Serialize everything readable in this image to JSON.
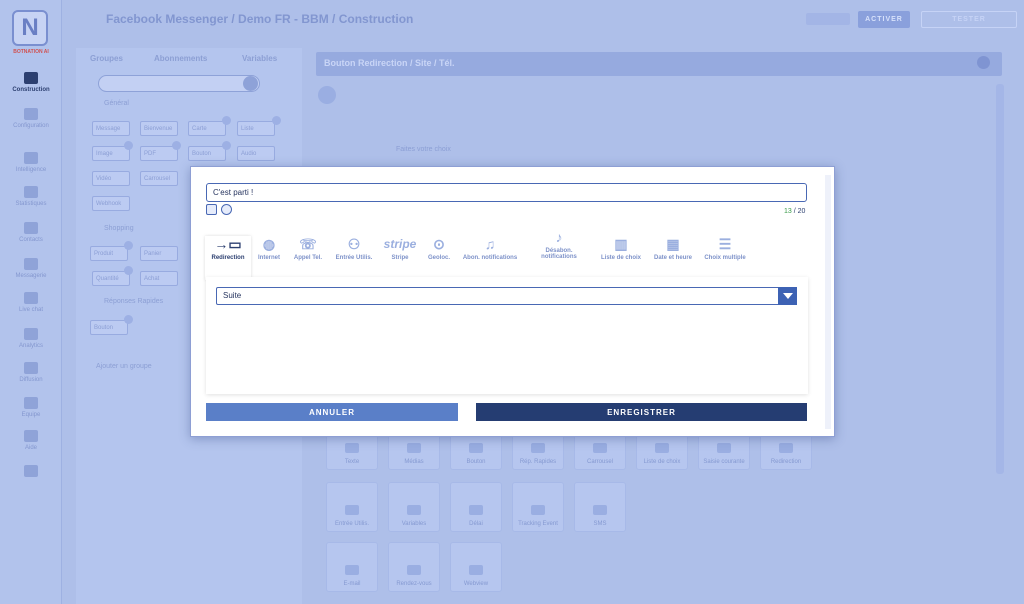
{
  "header": {
    "logo_letter": "N",
    "logo_text": "BOTNATION AI",
    "title": "Facebook Messenger / Demo FR - BBM / Construction",
    "activate_label": "ACTIVER",
    "test_label": "TESTER"
  },
  "rail": {
    "items": [
      {
        "label": "Construction",
        "icon": "wrench-icon",
        "active": true
      },
      {
        "label": "Configuration",
        "icon": "config-icon"
      },
      {
        "label": "Intelligence",
        "icon": "gear-icon"
      },
      {
        "label": "Statistiques",
        "icon": "stats-icon"
      },
      {
        "label": "Contacts",
        "icon": "contacts-icon"
      },
      {
        "label": "Messagerie",
        "icon": "chat-icon"
      },
      {
        "label": "Live chat",
        "icon": "headset-icon"
      },
      {
        "label": "Analytics",
        "icon": "chart-icon"
      },
      {
        "label": "Diffusion",
        "icon": "broadcast-icon"
      },
      {
        "label": "Equipe",
        "icon": "team-icon"
      },
      {
        "label": "Aide",
        "icon": "help-icon"
      },
      {
        "label": "",
        "icon": "gift-icon"
      }
    ]
  },
  "panel": {
    "tabs": [
      "Groupes",
      "Abonnements",
      "Variables"
    ],
    "section_general": "Général",
    "chips_general": [
      "Message",
      "Bienvenue",
      "Carte",
      "Liste",
      "Image",
      "PDF",
      "Bouton",
      "Audio",
      "Vidéo",
      "Carrousel",
      "Webhook"
    ],
    "section_ecommerce": "Shopping",
    "chips_ecommerce": [
      "Produit",
      "Panier",
      "Quantité",
      "Achat"
    ],
    "section_responses": "Réponses Rapides",
    "chips_responses": [
      "Bouton"
    ],
    "footer_label": "Ajouter un groupe"
  },
  "main": {
    "title": "Bouton Redirection / Site / Tél.",
    "flow_label": "Faites votre choix",
    "tiles_row1": [
      "Texte",
      "Médias",
      "Bouton",
      "Rép. Rapides",
      "Carrousel",
      "Liste de choix",
      "Saisie courante",
      "Redirection"
    ],
    "tiles_row2": [
      "Entrée Utilis.",
      "Variables",
      "Délai",
      "Tracking Event",
      "SMS"
    ],
    "tiles_row3": [
      "E-mail",
      "Rendez-vous",
      "Webview"
    ]
  },
  "modal": {
    "button_text": "C'est parti !",
    "counter_used": "13",
    "counter_sep": " / ",
    "counter_max": "20",
    "tabs": [
      {
        "label": "Redirection",
        "icon": "redirect-icon",
        "glyph": "→▭",
        "active": true
      },
      {
        "label": "Internet",
        "icon": "globe-icon",
        "glyph": "◍"
      },
      {
        "label": "Appel Tel.",
        "icon": "phone-icon",
        "glyph": "☏"
      },
      {
        "label": "Entrée Utilis.",
        "icon": "user-input-icon",
        "glyph": "⚇"
      },
      {
        "label": "Stripe",
        "icon": "stripe-icon",
        "glyph": "stripe"
      },
      {
        "label": "Geoloc.",
        "icon": "location-icon",
        "glyph": "⊙"
      },
      {
        "label": "Abon. notifications",
        "icon": "bell-icon",
        "glyph": "♫"
      },
      {
        "label": "Désabon. notifications",
        "icon": "bell-off-icon",
        "glyph": "♪"
      },
      {
        "label": "Liste de choix",
        "icon": "list-icon",
        "glyph": "▥"
      },
      {
        "label": "Date et heure",
        "icon": "calendar-icon",
        "glyph": "▦"
      },
      {
        "label": "Choix multiple",
        "icon": "checklist-icon",
        "glyph": "☰"
      }
    ],
    "select_value": "Suite",
    "cancel_label": "ANNULER",
    "save_label": "ENREGISTRER"
  },
  "colors": {
    "overlay": "#aebfe9",
    "primary": "#253d72",
    "secondary": "#5a7fc8",
    "accent": "#3d62b4",
    "counter_ok": "#3a9a4a"
  }
}
